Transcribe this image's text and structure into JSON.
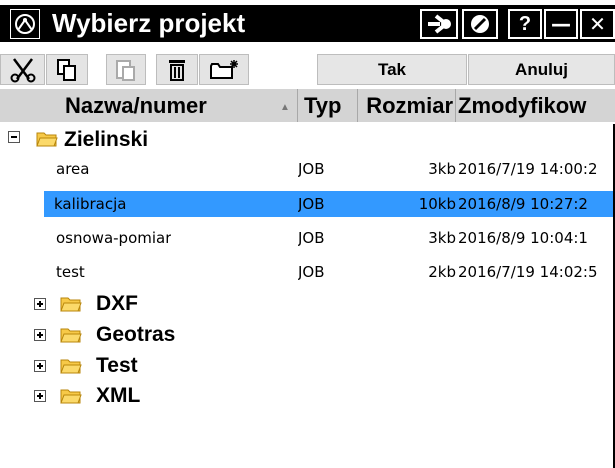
{
  "window": {
    "title": "Wybierz projekt",
    "buttons": {
      "forward_icon": "arrow-right-circle-icon",
      "cancel_icon": "no-entry-icon",
      "help": "?",
      "minimize": "—",
      "close": "✕"
    }
  },
  "toolbar": {
    "tools": [
      {
        "icon": "cut-icon"
      },
      {
        "icon": "copy-icon"
      },
      {
        "icon": "paste-icon"
      },
      {
        "icon": "delete-icon"
      },
      {
        "icon": "new-folder-icon"
      }
    ],
    "yes_label": "Tak",
    "cancel_label": "Anuluj"
  },
  "columns": {
    "name": "Nazwa/numer",
    "type": "Typ",
    "size": "Rozmiar",
    "modified": "Zmodyfikow"
  },
  "tree": {
    "root": {
      "label": "Zielinski",
      "expanded": true,
      "files": [
        {
          "name": "area",
          "type": "JOB",
          "size": "3kb",
          "modified": "2016/7/19 14:00:2",
          "selected": false
        },
        {
          "name": "kalibracja",
          "type": "JOB",
          "size": "10kb",
          "modified": "2016/8/9 10:27:2",
          "selected": true
        },
        {
          "name": "osnowa-pomiar",
          "type": "JOB",
          "size": "3kb",
          "modified": "2016/8/9 10:04:1",
          "selected": false
        },
        {
          "name": "test",
          "type": "JOB",
          "size": "2kb",
          "modified": "2016/7/19 14:02:5",
          "selected": false
        }
      ]
    },
    "folders": [
      {
        "label": "DXF"
      },
      {
        "label": "Geotras"
      },
      {
        "label": "Test"
      },
      {
        "label": "XML"
      }
    ]
  },
  "colors": {
    "selection": "#3399ff",
    "titlebar": "#000000",
    "folder": "#f7c948"
  }
}
